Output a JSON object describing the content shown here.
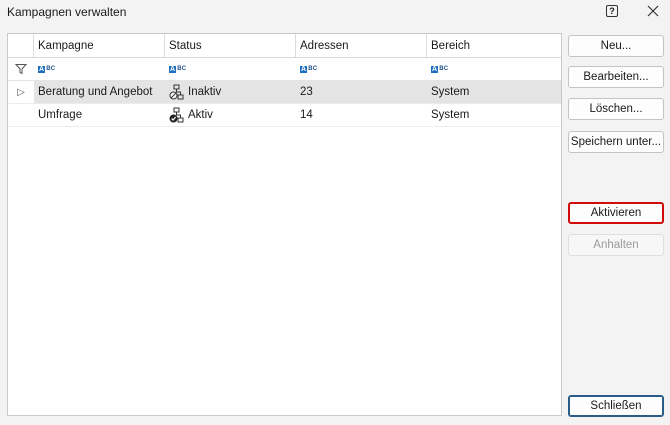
{
  "window": {
    "title": "Kampagnen verwalten",
    "help_icon": "question-mark-icon",
    "help_glyph": "?",
    "close_icon": "close-icon"
  },
  "grid": {
    "columns": [
      "Kampagne",
      "Status",
      "Adressen",
      "Bereich"
    ],
    "filter_row": {
      "icon": "filter-icon",
      "cell_icon": "text-filter-icon",
      "cell_label": "ABC"
    },
    "rows": [
      {
        "expander": "▷",
        "name": "Beratung und Angebot",
        "status": "Inaktiv",
        "status_icon": "workflow-inactive-icon",
        "addresses": "23",
        "area": "System",
        "selected": true
      },
      {
        "expander": "",
        "name": "Umfrage",
        "status": "Aktiv",
        "status_icon": "workflow-active-icon",
        "addresses": "14",
        "area": "System",
        "selected": false
      }
    ]
  },
  "buttons": {
    "new": "Neu...",
    "edit": "Bearbeiten...",
    "delete": "Löschen...",
    "save_as": "Speichern unter...",
    "activate": "Aktivieren",
    "pause": "Anhalten",
    "close": "Schließen"
  },
  "colors": {
    "highlight_border": "#d10a0a",
    "selected_row": "#e4e4e4",
    "primary_border": "#2a5c8a"
  }
}
